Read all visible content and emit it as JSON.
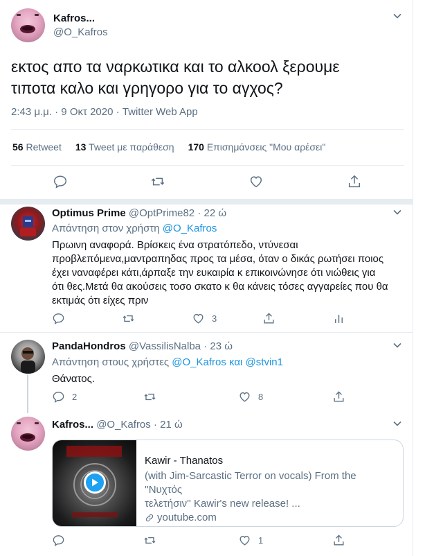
{
  "main_tweet": {
    "display_name": "Kafros...",
    "handle": "@O_Kafros",
    "text_line1": "εκτος απο τα ναρκωτικα και το αλκοολ ξερουμε",
    "text_line2": "τιποτα καλο και γρηγορο για το αγχος?",
    "meta": "2:43 μ.μ. · 9 Οκτ 2020 · Twitter Web App",
    "stats": {
      "retweets_count": "56",
      "retweets_label": "Retweet",
      "quotes_count": "13",
      "quotes_label": "Tweet με παράθεση",
      "likes_count": "170",
      "likes_label": "Επισημάνσεις \"Μου αρέσει\""
    }
  },
  "reply1": {
    "display_name": "Optimus Prime",
    "handle": "@OptPrime82",
    "time": "· 22 ώ",
    "reply_prefix": "Απάντηση στον χρήστη",
    "reply_to": "@O_Kafros",
    "lines": [
      "Πρωινη αναφορά. Βρίσκεις ένα στρατόπεδο, ντύνεσαι",
      "προβλεπόμενα,μαντραπηδας προς τα μέσα, όταν ο δικάς ρωτήσει ποιος",
      "έχει ναναφέρει κάτι,άρπαξε την ευκαιρία κ επικοινώνησε ότι νιώθεις για",
      "ότι θες.Μετά θα ακούσεις τοσο σκατο κ θα κάνεις τόσες αγγαρείες που θα",
      "εκτιμάς ότι είχες πριν"
    ],
    "like_count": "3"
  },
  "reply2": {
    "display_name": "PandaHondros",
    "handle": "@VassilisNalba",
    "time": "· 23 ώ",
    "reply_prefix": "Απάντηση στους χρήστες",
    "reply_to1": "@O_Kafros",
    "reply_and": "και",
    "reply_to2": "@stvin1",
    "text": "Θάνατος.",
    "reply_count": "2",
    "like_count": "8"
  },
  "reply3": {
    "display_name": "Kafros...",
    "handle": "@O_Kafros",
    "time": "· 21 ώ",
    "card": {
      "title": "Kawir - Thanatos",
      "desc_line1": "(with Jim-Sarcastic Terror on vocals) From the ''Νυχτός",
      "desc_line2": "τελετήσιν'' Kawir's new release! ...",
      "domain": "youtube.com"
    },
    "like_count": "1"
  },
  "icons": {
    "chevron": "chevron-down-icon",
    "reply": "reply-icon",
    "retweet": "retweet-icon",
    "like": "heart-icon",
    "share": "share-icon",
    "analytics": "analytics-icon",
    "link": "link-icon",
    "play": "play-icon"
  },
  "colors": {
    "link_blue": "#1b95e0",
    "secondary_text": "#5b7083",
    "border": "#e6ecf0"
  }
}
